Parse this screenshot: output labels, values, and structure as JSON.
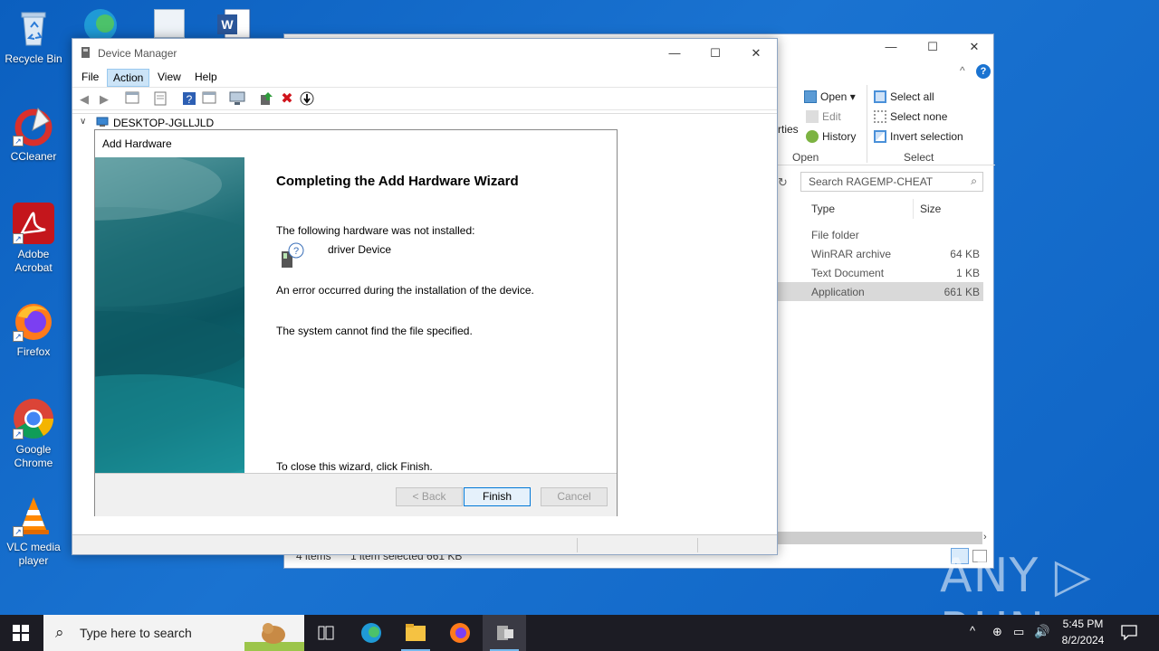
{
  "desktop": {
    "icons": [
      {
        "label": "Recycle Bin"
      },
      {
        "label": "CCleaner"
      },
      {
        "label": "Adobe Acrobat"
      },
      {
        "label": "Firefox"
      },
      {
        "label": "Google Chrome"
      },
      {
        "label": "VLC media player"
      }
    ]
  },
  "explorer": {
    "ribbon": {
      "open": "Open",
      "edit": "Edit",
      "history": "History",
      "properties_partial": "rties",
      "select_all": "Select all",
      "select_none": "Select none",
      "invert_selection": "Invert selection",
      "group_open": "Open",
      "group_select": "Select"
    },
    "search_placeholder": "Search RAGEMP-CHEAT",
    "columns": {
      "type": "Type",
      "size": "Size"
    },
    "rows": [
      {
        "type": "File folder",
        "size": ""
      },
      {
        "type": "WinRAR archive",
        "size": "64 KB"
      },
      {
        "type": "Text Document",
        "size": "1 KB"
      },
      {
        "type": "Application",
        "size": "661 KB"
      }
    ],
    "status": {
      "items": "4 items",
      "selected": "1 item selected  661 KB"
    }
  },
  "device_manager": {
    "title": "Device Manager",
    "menu": [
      "File",
      "Action",
      "View",
      "Help"
    ],
    "tree_root": "DESKTOP-JGLLJLD"
  },
  "wizard": {
    "title": "Add Hardware",
    "heading": "Completing the Add Hardware Wizard",
    "not_installed": "The following hardware was not installed:",
    "device_name": "driver Device",
    "error_line": "An error occurred during the installation of the device.",
    "error_detail": "The system cannot find the file specified.",
    "close_hint": "To close this wizard, click Finish.",
    "buttons": {
      "back": "< Back",
      "finish": "Finish",
      "cancel": "Cancel"
    }
  },
  "taskbar": {
    "search_placeholder": "Type here to search",
    "time": "5:45 PM",
    "date": "8/2/2024"
  },
  "watermark": "ANY ▷ RUN"
}
